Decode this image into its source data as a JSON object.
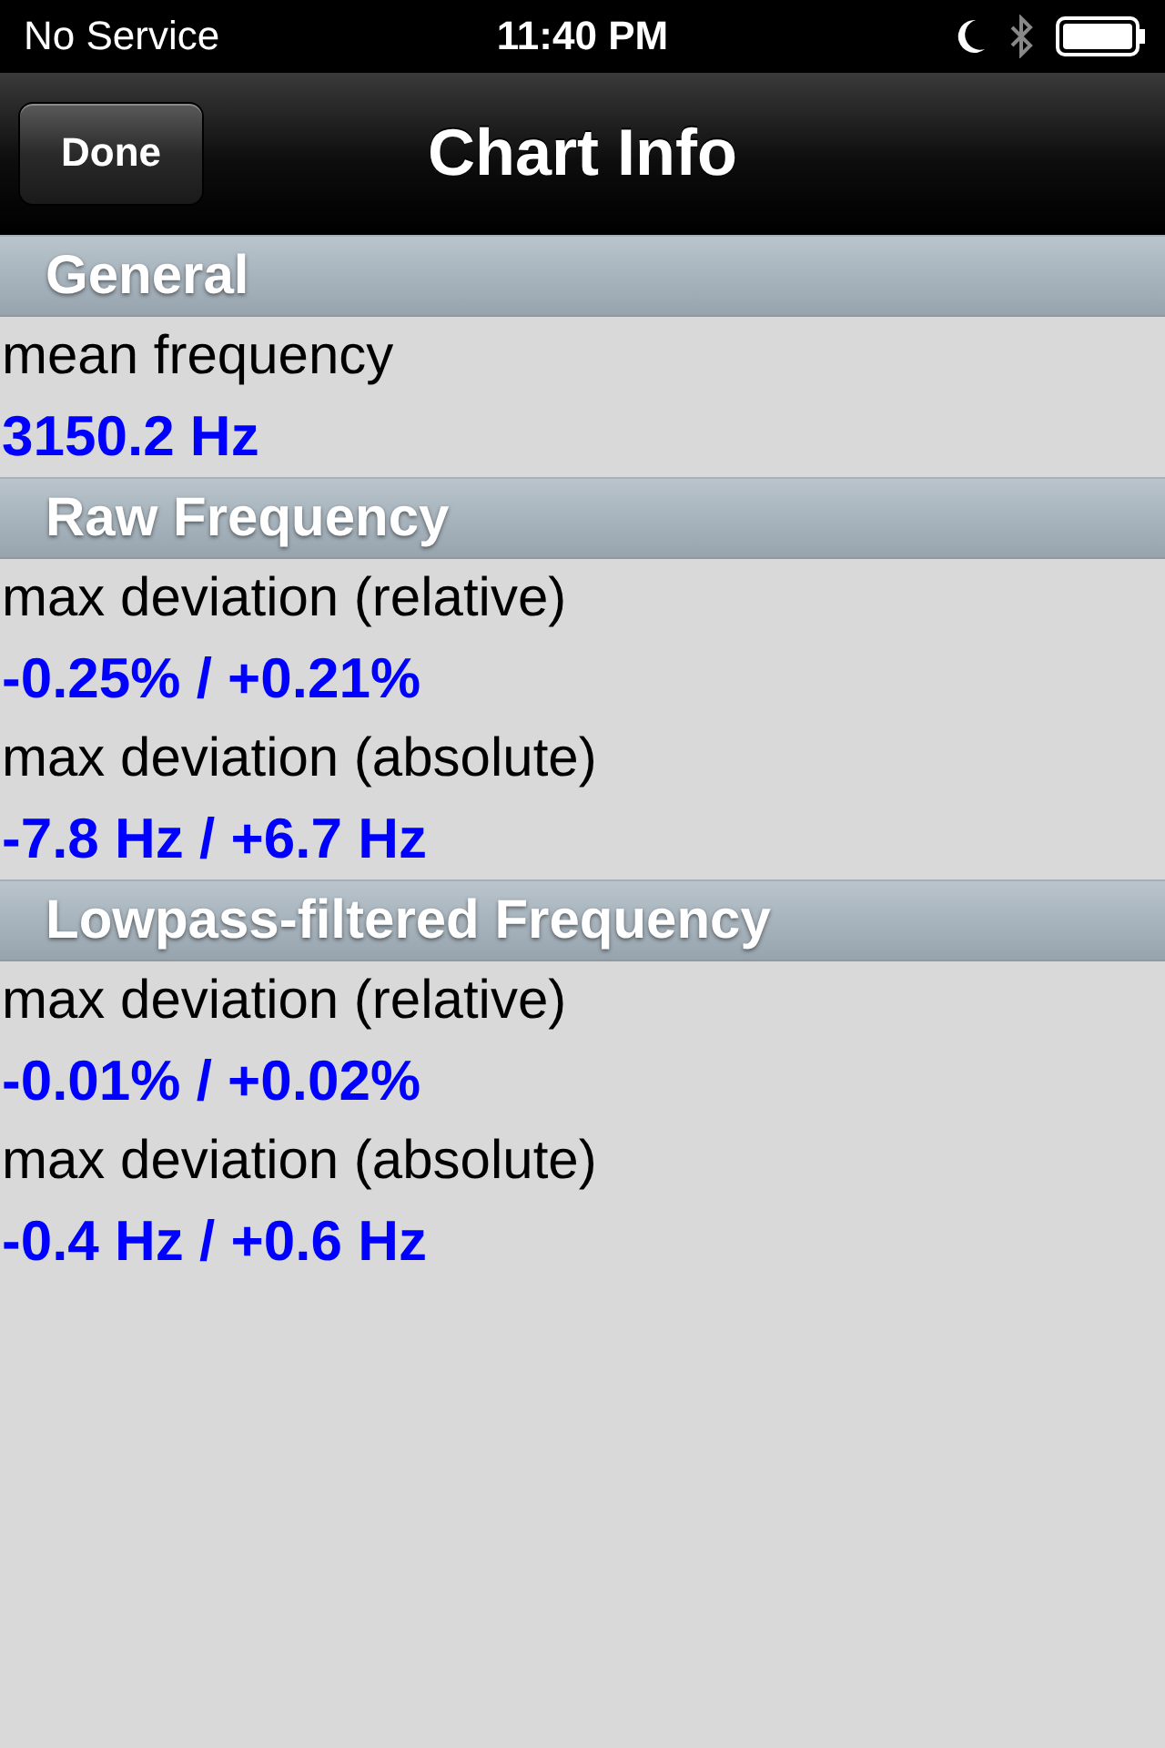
{
  "status_bar": {
    "carrier": "No Service",
    "time": "11:40 PM"
  },
  "nav_bar": {
    "button": "Done",
    "title": "Chart Info"
  },
  "sections": [
    {
      "title": "General",
      "rows": [
        {
          "label": "mean frequency",
          "value": "3150.2 Hz"
        }
      ]
    },
    {
      "title": "Raw Frequency",
      "rows": [
        {
          "label": "max deviation (relative)",
          "value": "-0.25% / +0.21%"
        },
        {
          "label": "max deviation (absolute)",
          "value": "-7.8 Hz / +6.7 Hz"
        }
      ]
    },
    {
      "title": "Lowpass-filtered Frequency",
      "rows": [
        {
          "label": "max deviation (relative)",
          "value": "-0.01% / +0.02%"
        },
        {
          "label": "max deviation (absolute)",
          "value": "-0.4 Hz / +0.6 Hz"
        }
      ]
    }
  ]
}
